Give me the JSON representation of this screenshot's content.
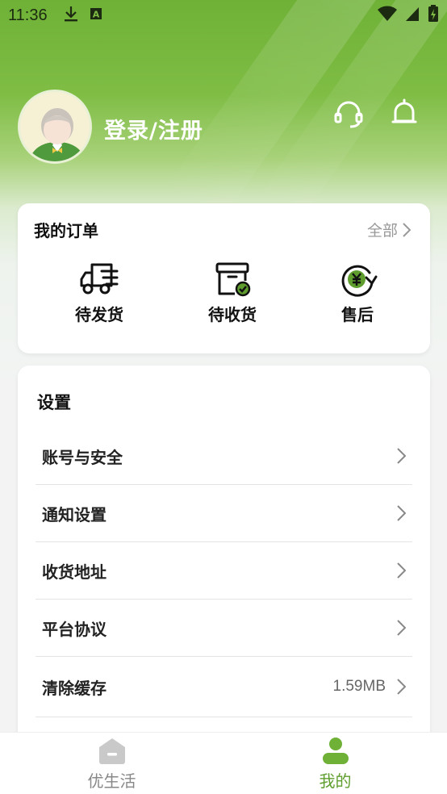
{
  "status_bar": {
    "time": "11:36",
    "icons": [
      "download-icon",
      "sim-a-icon",
      "wifi-icon",
      "signal-icon",
      "battery-icon"
    ]
  },
  "header": {
    "login_label": "登录/注册",
    "icons": [
      "headset-icon",
      "bell-icon"
    ]
  },
  "orders": {
    "title": "我的订单",
    "all_label": "全部",
    "items": [
      {
        "label": "待发货",
        "icon": "truck-icon"
      },
      {
        "label": "待收货",
        "icon": "box-check-icon"
      },
      {
        "label": "售后",
        "icon": "yuan-refresh-icon"
      }
    ]
  },
  "settings": {
    "title": "设置",
    "rows": [
      {
        "label": "账号与安全",
        "value": ""
      },
      {
        "label": "通知设置",
        "value": ""
      },
      {
        "label": "收货地址",
        "value": ""
      },
      {
        "label": "平台协议",
        "value": ""
      },
      {
        "label": "清除缓存",
        "value": "1.59MB"
      }
    ]
  },
  "tabbar": {
    "tabs": [
      {
        "label": "优生活",
        "icon": "home-icon",
        "active": false
      },
      {
        "label": "我的",
        "icon": "person-icon",
        "active": true
      }
    ]
  },
  "colors": {
    "accent": "#6fb137",
    "active_tab": "#5f9e2e"
  }
}
